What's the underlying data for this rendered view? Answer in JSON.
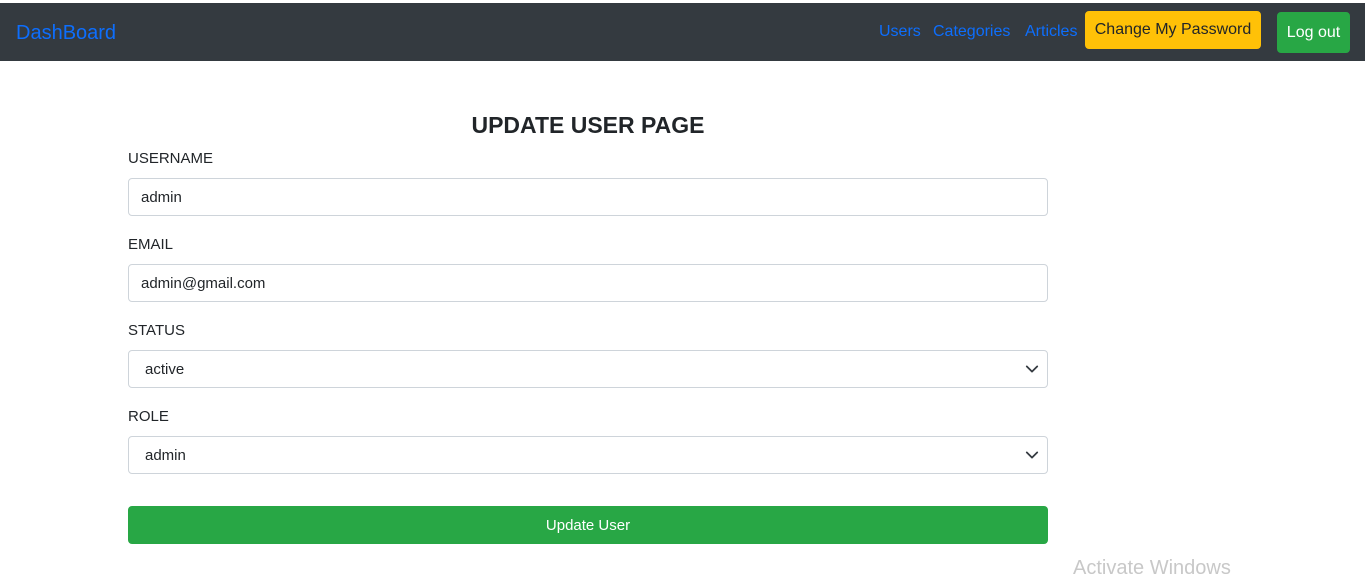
{
  "navbar": {
    "brand": "DashBoard",
    "links": [
      "Users",
      "Categories",
      "Articles"
    ],
    "change_password_label": "Change My Password",
    "logout_label": "Log out"
  },
  "form": {
    "title": "UPDATE USER PAGE",
    "username": {
      "label": "USERNAME",
      "value": "admin"
    },
    "email": {
      "label": "EMAIL",
      "value": "admin@gmail.com"
    },
    "status": {
      "label": "STATUS",
      "value": "active"
    },
    "role": {
      "label": "ROLE",
      "value": "admin"
    },
    "submit_label": "Update User"
  },
  "watermark": "Activate Windows",
  "colors": {
    "navbar_bg": "#343a40",
    "link": "#0d6efd",
    "warning": "#ffc107",
    "success": "#28a745"
  }
}
